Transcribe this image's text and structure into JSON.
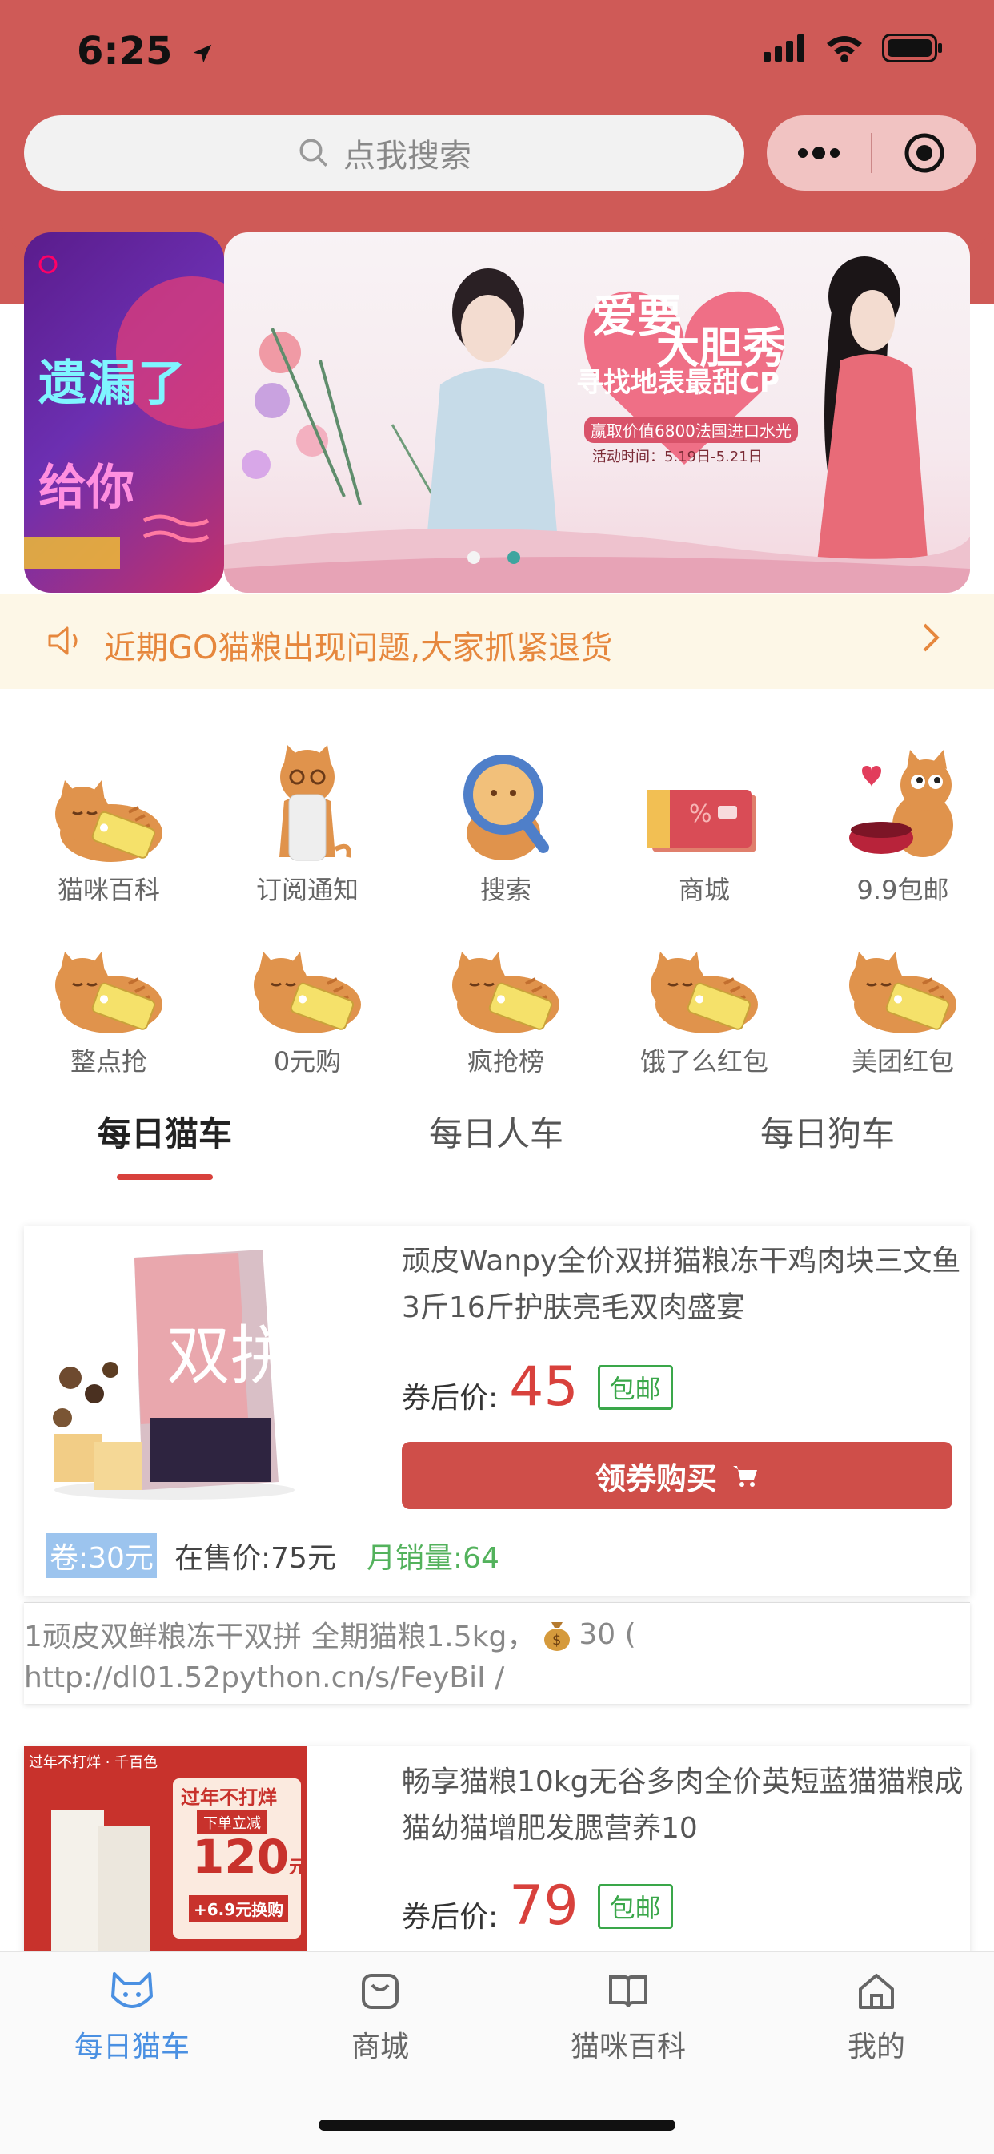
{
  "status_bar": {
    "time": "6:25"
  },
  "search": {
    "placeholder": "点我搜索"
  },
  "banner": {
    "left_line1": "遗漏了",
    "left_line2": "给你",
    "main_title_line1": "爱要",
    "main_title_line2": "大胆秀",
    "main_subtitle": "寻找地表最甜CP",
    "main_prize": "赢取价值6800法国进口水光",
    "main_date": "活动时间：5.19日-5.21日"
  },
  "notice": {
    "text": "近期GO猫粮出现问题,大家抓紧退货"
  },
  "grid": [
    {
      "label": "猫咪百科",
      "icon": "cat-tag-icon"
    },
    {
      "label": "订阅通知",
      "icon": "cat-bottle-icon"
    },
    {
      "label": "搜索",
      "icon": "cat-magnifier-icon"
    },
    {
      "label": "商城",
      "icon": "card-icon"
    },
    {
      "label": "9.9包邮",
      "icon": "cat-bowl-icon"
    },
    {
      "label": "整点抢",
      "icon": "cat-tag-icon"
    },
    {
      "label": "0元购",
      "icon": "cat-tag-icon"
    },
    {
      "label": "疯抢榜",
      "icon": "cat-tag-icon"
    },
    {
      "label": "饿了么红包",
      "icon": "cat-tag-icon"
    },
    {
      "label": "美团红包",
      "icon": "cat-tag-icon"
    }
  ],
  "tabs": [
    {
      "label": "每日猫车",
      "active": true
    },
    {
      "label": "每日人车",
      "active": false
    },
    {
      "label": "每日狗车",
      "active": false
    }
  ],
  "products": [
    {
      "title": "顽皮Wanpy全价双拼猫粮冻干鸡肉块三文鱼3斤16斤护肤亮毛双肉盛宴",
      "price_label": "券后价:",
      "price": "45",
      "free_shipping": "包邮",
      "buy_label": "领券购买",
      "coupon": "卷:30元",
      "original_price": "在售价:75元",
      "monthly_sales": "月销量:64",
      "description_line1": "1顽皮双鲜粮冻干双拼 全期猫粮1.5kg，",
      "description_amount": "30 (",
      "description_line2": "http://dl01.52python.cn/s/FeyBiI /",
      "image_caption": "双拼"
    },
    {
      "title": "畅享猫粮10kg无谷多肉全价英短蓝猫猫粮成猫幼猫增肥发腮营养10",
      "price_label": "券后价:",
      "price": "79",
      "free_shipping": "包邮",
      "image_top_left": "过年不打烊 · 千百色",
      "image_banner": "过年不打烊",
      "image_sub": "下单立减",
      "image_amount": "120",
      "image_unit": "元",
      "image_promo": "+6.9元换购"
    }
  ],
  "bottom_nav": [
    {
      "label": "每日猫车",
      "icon": "cat-face-icon",
      "active": true
    },
    {
      "label": "商城",
      "icon": "bag-icon",
      "active": false
    },
    {
      "label": "猫咪百科",
      "icon": "book-icon",
      "active": false
    },
    {
      "label": "我的",
      "icon": "home-icon",
      "active": false
    }
  ],
  "colors": {
    "header": "#cf5a57",
    "accent_red": "#d8413c",
    "notice_text": "#e6873d",
    "green": "#3aa74a",
    "nav_active": "#4a90e2"
  }
}
